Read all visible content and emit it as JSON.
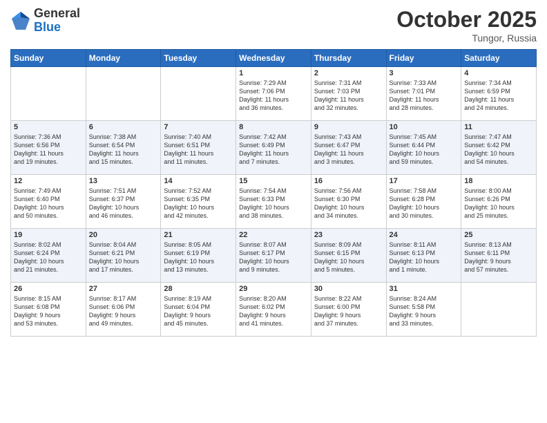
{
  "header": {
    "logo_general": "General",
    "logo_blue": "Blue",
    "month_title": "October 2025",
    "location": "Tungor, Russia"
  },
  "days_of_week": [
    "Sunday",
    "Monday",
    "Tuesday",
    "Wednesday",
    "Thursday",
    "Friday",
    "Saturday"
  ],
  "weeks": [
    [
      {
        "day": "",
        "info": ""
      },
      {
        "day": "",
        "info": ""
      },
      {
        "day": "",
        "info": ""
      },
      {
        "day": "1",
        "info": "Sunrise: 7:29 AM\nSunset: 7:06 PM\nDaylight: 11 hours\nand 36 minutes."
      },
      {
        "day": "2",
        "info": "Sunrise: 7:31 AM\nSunset: 7:03 PM\nDaylight: 11 hours\nand 32 minutes."
      },
      {
        "day": "3",
        "info": "Sunrise: 7:33 AM\nSunset: 7:01 PM\nDaylight: 11 hours\nand 28 minutes."
      },
      {
        "day": "4",
        "info": "Sunrise: 7:34 AM\nSunset: 6:59 PM\nDaylight: 11 hours\nand 24 minutes."
      }
    ],
    [
      {
        "day": "5",
        "info": "Sunrise: 7:36 AM\nSunset: 6:56 PM\nDaylight: 11 hours\nand 19 minutes."
      },
      {
        "day": "6",
        "info": "Sunrise: 7:38 AM\nSunset: 6:54 PM\nDaylight: 11 hours\nand 15 minutes."
      },
      {
        "day": "7",
        "info": "Sunrise: 7:40 AM\nSunset: 6:51 PM\nDaylight: 11 hours\nand 11 minutes."
      },
      {
        "day": "8",
        "info": "Sunrise: 7:42 AM\nSunset: 6:49 PM\nDaylight: 11 hours\nand 7 minutes."
      },
      {
        "day": "9",
        "info": "Sunrise: 7:43 AM\nSunset: 6:47 PM\nDaylight: 11 hours\nand 3 minutes."
      },
      {
        "day": "10",
        "info": "Sunrise: 7:45 AM\nSunset: 6:44 PM\nDaylight: 10 hours\nand 59 minutes."
      },
      {
        "day": "11",
        "info": "Sunrise: 7:47 AM\nSunset: 6:42 PM\nDaylight: 10 hours\nand 54 minutes."
      }
    ],
    [
      {
        "day": "12",
        "info": "Sunrise: 7:49 AM\nSunset: 6:40 PM\nDaylight: 10 hours\nand 50 minutes."
      },
      {
        "day": "13",
        "info": "Sunrise: 7:51 AM\nSunset: 6:37 PM\nDaylight: 10 hours\nand 46 minutes."
      },
      {
        "day": "14",
        "info": "Sunrise: 7:52 AM\nSunset: 6:35 PM\nDaylight: 10 hours\nand 42 minutes."
      },
      {
        "day": "15",
        "info": "Sunrise: 7:54 AM\nSunset: 6:33 PM\nDaylight: 10 hours\nand 38 minutes."
      },
      {
        "day": "16",
        "info": "Sunrise: 7:56 AM\nSunset: 6:30 PM\nDaylight: 10 hours\nand 34 minutes."
      },
      {
        "day": "17",
        "info": "Sunrise: 7:58 AM\nSunset: 6:28 PM\nDaylight: 10 hours\nand 30 minutes."
      },
      {
        "day": "18",
        "info": "Sunrise: 8:00 AM\nSunset: 6:26 PM\nDaylight: 10 hours\nand 25 minutes."
      }
    ],
    [
      {
        "day": "19",
        "info": "Sunrise: 8:02 AM\nSunset: 6:24 PM\nDaylight: 10 hours\nand 21 minutes."
      },
      {
        "day": "20",
        "info": "Sunrise: 8:04 AM\nSunset: 6:21 PM\nDaylight: 10 hours\nand 17 minutes."
      },
      {
        "day": "21",
        "info": "Sunrise: 8:05 AM\nSunset: 6:19 PM\nDaylight: 10 hours\nand 13 minutes."
      },
      {
        "day": "22",
        "info": "Sunrise: 8:07 AM\nSunset: 6:17 PM\nDaylight: 10 hours\nand 9 minutes."
      },
      {
        "day": "23",
        "info": "Sunrise: 8:09 AM\nSunset: 6:15 PM\nDaylight: 10 hours\nand 5 minutes."
      },
      {
        "day": "24",
        "info": "Sunrise: 8:11 AM\nSunset: 6:13 PM\nDaylight: 10 hours\nand 1 minute."
      },
      {
        "day": "25",
        "info": "Sunrise: 8:13 AM\nSunset: 6:11 PM\nDaylight: 9 hours\nand 57 minutes."
      }
    ],
    [
      {
        "day": "26",
        "info": "Sunrise: 8:15 AM\nSunset: 6:08 PM\nDaylight: 9 hours\nand 53 minutes."
      },
      {
        "day": "27",
        "info": "Sunrise: 8:17 AM\nSunset: 6:06 PM\nDaylight: 9 hours\nand 49 minutes."
      },
      {
        "day": "28",
        "info": "Sunrise: 8:19 AM\nSunset: 6:04 PM\nDaylight: 9 hours\nand 45 minutes."
      },
      {
        "day": "29",
        "info": "Sunrise: 8:20 AM\nSunset: 6:02 PM\nDaylight: 9 hours\nand 41 minutes."
      },
      {
        "day": "30",
        "info": "Sunrise: 8:22 AM\nSunset: 6:00 PM\nDaylight: 9 hours\nand 37 minutes."
      },
      {
        "day": "31",
        "info": "Sunrise: 8:24 AM\nSunset: 5:58 PM\nDaylight: 9 hours\nand 33 minutes."
      },
      {
        "day": "",
        "info": ""
      }
    ]
  ]
}
